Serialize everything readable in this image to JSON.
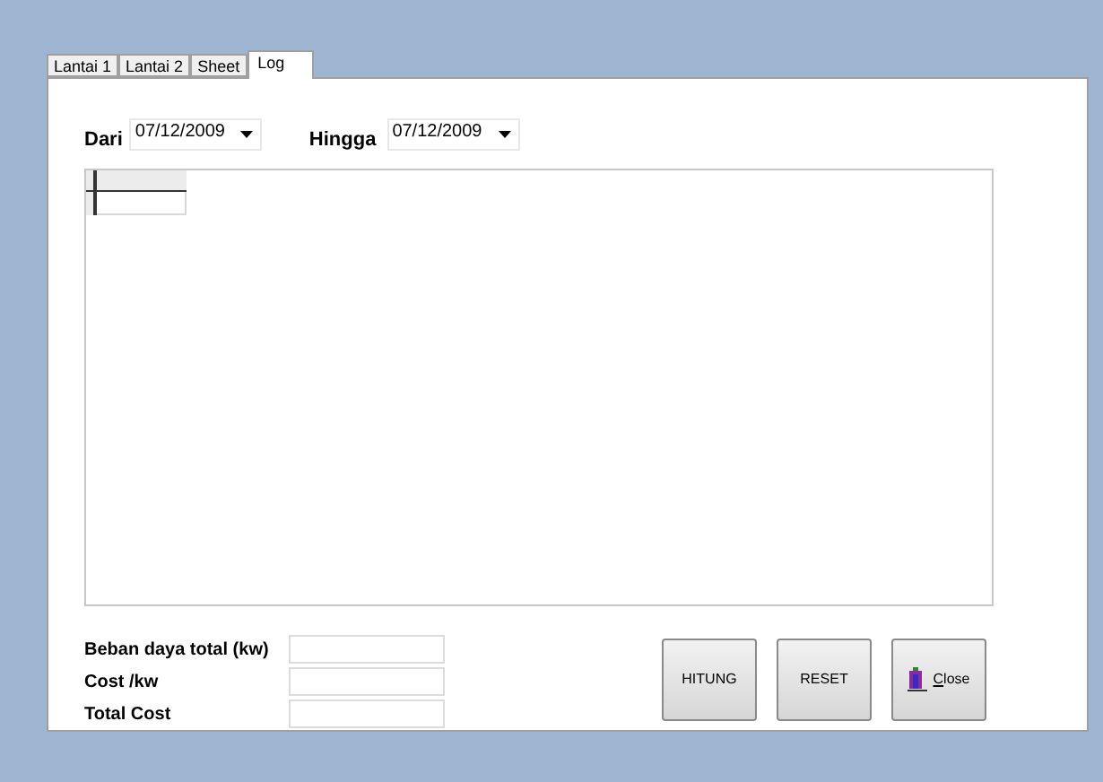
{
  "tabs": [
    {
      "label": "Lantai 1",
      "selected": false
    },
    {
      "label": "Lantai 2",
      "selected": false
    },
    {
      "label": "Sheet",
      "selected": false
    },
    {
      "label": "Log",
      "selected": true
    }
  ],
  "date_range": {
    "from": {
      "label": "Dari",
      "value": "07/12/2009"
    },
    "to": {
      "label": "Hingga",
      "value": "07/12/2009"
    }
  },
  "summary_fields": [
    {
      "label": "Beban daya total (kw)"
    },
    {
      "label": "Cost /kw"
    },
    {
      "label": "Total Cost"
    }
  ],
  "buttons": [
    {
      "label": "HITUNG",
      "kind": "text"
    },
    {
      "label": "RESET",
      "kind": "text"
    },
    {
      "label": "Close",
      "kind": "close"
    }
  ]
}
